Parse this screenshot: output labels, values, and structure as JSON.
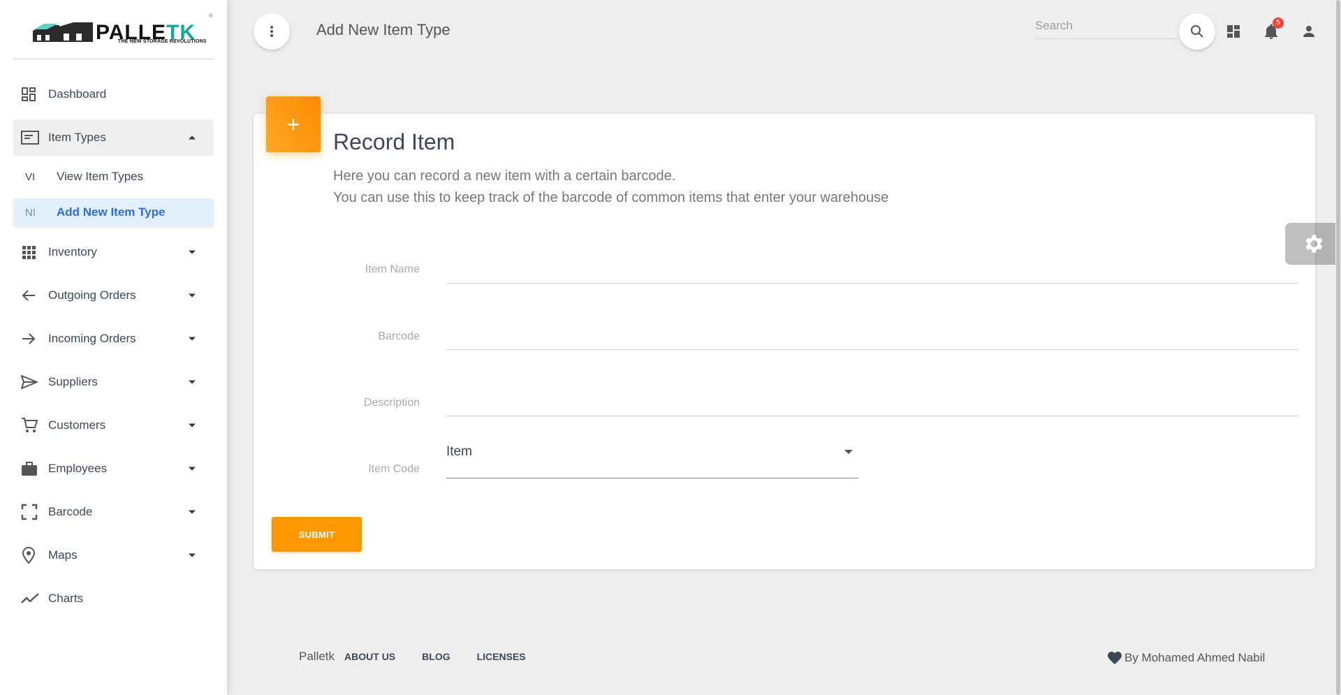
{
  "sidebar": {
    "logo": {
      "brand": "PALLE",
      "brand_accent": "TK",
      "tagline": "THE NEW STORAGE REVOLUTIONS",
      "registered": "®"
    },
    "items": [
      {
        "label": "Dashboard",
        "icon": "dashboard-icon"
      },
      {
        "label": "Item Types",
        "icon": "item-types-icon",
        "expanded": true
      },
      {
        "label": "Inventory",
        "icon": "grid-icon"
      },
      {
        "label": "Outgoing Orders",
        "icon": "arrow-left-icon"
      },
      {
        "label": "Incoming Orders",
        "icon": "arrow-right-icon"
      },
      {
        "label": "Suppliers",
        "icon": "send-icon"
      },
      {
        "label": "Customers",
        "icon": "cart-icon"
      },
      {
        "label": "Employees",
        "icon": "briefcase-icon"
      },
      {
        "label": "Barcode",
        "icon": "scan-icon"
      },
      {
        "label": "Maps",
        "icon": "map-pin-icon"
      },
      {
        "label": "Charts",
        "icon": "chart-icon"
      }
    ],
    "subitems": [
      {
        "abbr": "VI",
        "label": "View Item Types"
      },
      {
        "abbr": "NI",
        "label": "Add New Item Type",
        "active": true
      }
    ]
  },
  "header": {
    "title": "Add New Item Type",
    "search_placeholder": "Search",
    "notification_count": "5"
  },
  "card": {
    "icon_symbol": "+",
    "title": "Record Item",
    "description_line1": "Here you can record a new item with a certain barcode.",
    "description_line2": "You can use this to keep track of the barcode of common items that enter your warehouse",
    "fields": {
      "item_name_label": "Item Name",
      "barcode_label": "Barcode",
      "description_label": "Description",
      "item_code_label": "Item Code",
      "item_code_value": "Item"
    },
    "submit_label": "SUBMIT"
  },
  "footer": {
    "brand": "Palletk",
    "links": [
      "ABOUT US",
      "BLOG",
      "LICENSES"
    ],
    "credit": "By Mohamed Ahmed Nabil"
  },
  "colors": {
    "accent": "#ff9800",
    "active_link": "#2e6fd8",
    "badge": "#f44336"
  }
}
